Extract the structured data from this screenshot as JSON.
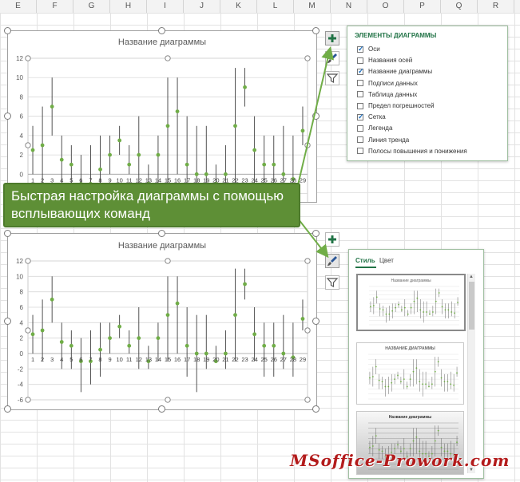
{
  "columns": [
    "E",
    "F",
    "G",
    "H",
    "I",
    "J",
    "K",
    "L",
    "M",
    "N",
    "O",
    "P",
    "Q",
    "R"
  ],
  "chart1": {
    "title": "Название диаграммы"
  },
  "chart2": {
    "title": "Название диаграммы"
  },
  "chart_data": [
    {
      "type": "scatter",
      "title": "Название диаграммы",
      "xlabel": "",
      "ylabel": "",
      "x": [
        1,
        2,
        3,
        4,
        5,
        6,
        7,
        8,
        9,
        10,
        11,
        12,
        13,
        14,
        15,
        16,
        17,
        18,
        19,
        20,
        21,
        22,
        23,
        24,
        25,
        26,
        27,
        28,
        29
      ],
      "y": [
        2.5,
        3,
        7,
        1.5,
        1,
        -1,
        -1,
        0.5,
        2,
        3.5,
        1,
        2,
        -1,
        2,
        5,
        6.5,
        1,
        0,
        0,
        -1,
        0,
        5,
        9,
        2.5,
        1,
        1,
        0,
        -0.5,
        4.5
      ],
      "error_low": [
        0,
        -1,
        4,
        -2,
        -2,
        -5,
        -4,
        -3,
        0,
        2,
        0,
        -2,
        -2,
        -1,
        -1,
        0,
        -3,
        -5,
        -2,
        -1,
        -2,
        -1,
        7,
        -1,
        -3,
        -3,
        -2,
        -3,
        3
      ],
      "error_high": [
        5,
        7,
        10,
        4,
        3,
        2,
        3,
        4,
        4,
        5,
        3,
        6,
        1,
        4,
        10,
        10,
        6,
        5,
        5,
        1,
        3,
        11,
        11,
        6,
        4,
        4,
        5,
        4,
        7
      ],
      "ylim": [
        -6,
        12
      ],
      "yticks": [
        -6,
        -4,
        -2,
        0,
        2,
        4,
        6,
        8,
        10,
        12
      ],
      "grid": true,
      "color": "#70ad47"
    },
    {
      "type": "scatter",
      "title": "Название диаграммы",
      "x": [
        1,
        2,
        3,
        4,
        5,
        6,
        7,
        8,
        9,
        10,
        11,
        12,
        13,
        14,
        15,
        16,
        17,
        18,
        19,
        20,
        21,
        22,
        23,
        24,
        25,
        26,
        27,
        28,
        29
      ],
      "y": [
        2.5,
        3,
        7,
        1.5,
        1,
        -1,
        -1,
        0.5,
        2,
        3.5,
        1,
        2,
        -1,
        2,
        5,
        6.5,
        1,
        0,
        0,
        -1,
        0,
        5,
        9,
        2.5,
        1,
        1,
        0,
        -0.5,
        4.5
      ],
      "error_low": [
        0,
        -1,
        4,
        -2,
        -2,
        -5,
        -4,
        -3,
        0,
        2,
        0,
        -2,
        -2,
        -1,
        -1,
        0,
        -3,
        -5,
        -2,
        -1,
        -2,
        -1,
        7,
        -1,
        -3,
        -3,
        -2,
        -3,
        3
      ],
      "error_high": [
        5,
        7,
        10,
        4,
        3,
        2,
        3,
        4,
        4,
        5,
        3,
        6,
        1,
        4,
        10,
        10,
        6,
        5,
        5,
        1,
        3,
        11,
        11,
        6,
        4,
        4,
        5,
        4,
        7
      ],
      "ylim": [
        -6,
        12
      ],
      "yticks": [
        -6,
        -4,
        -2,
        0,
        2,
        4,
        6,
        8,
        10,
        12
      ],
      "grid": true,
      "color": "#70ad47"
    }
  ],
  "elements_pane": {
    "title": "ЭЛЕМЕНТЫ ДИАГРАММЫ",
    "items": [
      {
        "label": "Оси",
        "checked": true
      },
      {
        "label": "Названия осей",
        "checked": false
      },
      {
        "label": "Название диаграммы",
        "checked": true
      },
      {
        "label": "Подписи данных",
        "checked": false
      },
      {
        "label": "Таблица данных",
        "checked": false
      },
      {
        "label": "Предел погрешностей",
        "checked": false
      },
      {
        "label": "Сетка",
        "checked": true
      },
      {
        "label": "Легенда",
        "checked": false
      },
      {
        "label": "Линия тренда",
        "checked": false
      },
      {
        "label": "Полосы повышения и понижения",
        "checked": false
      }
    ]
  },
  "style_pane": {
    "tabs": [
      {
        "label": "Стиль",
        "active": true
      },
      {
        "label": "Цвет",
        "active": false
      }
    ],
    "thumbs": [
      {
        "title": "Название диаграммы"
      },
      {
        "title": "НАЗВАНИЕ ДИАГРАММЫ"
      },
      {
        "title": "Название диаграммы"
      }
    ]
  },
  "callout": {
    "text": "Быстрая настройка диаграммы с помощью всплывающих команд"
  },
  "watermark": {
    "text": "MSoffice-Prowork.com"
  },
  "colors": {
    "accent": "#70ad47",
    "callout": "#5e8f36",
    "excel_green": "#217346"
  }
}
